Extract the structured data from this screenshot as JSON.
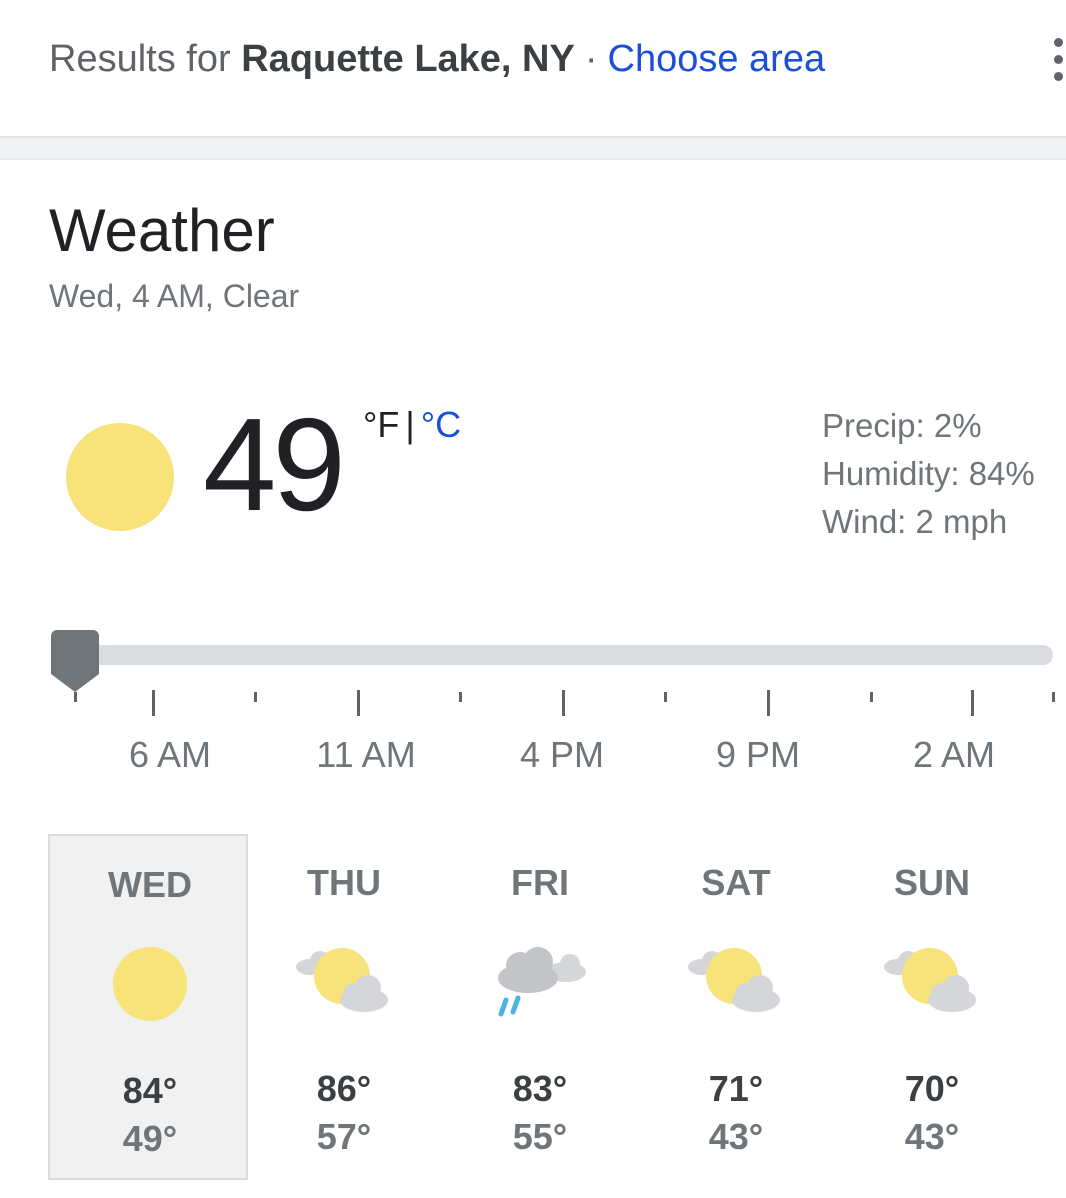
{
  "header": {
    "results_prefix": "Results for",
    "location": "Raquette Lake, NY",
    "separator": "·",
    "choose_area": "Choose area",
    "more_icon": "more-vert-icon"
  },
  "weather": {
    "title": "Weather",
    "subtitle": "Wed, 4 AM, Clear",
    "condition_icon": "sun-icon",
    "temperature": "49",
    "unit_f": "°F",
    "unit_sep": "|",
    "unit_c": "°C",
    "precip": "Precip: 2%",
    "humidity": "Humidity: 84%",
    "wind": "Wind: 2 mph"
  },
  "timeline": {
    "position_fraction": 0,
    "labels": [
      "6 AM",
      "11 AM",
      "4 PM",
      "9 PM",
      "2 AM"
    ]
  },
  "colors": {
    "sun": "#f8e27a",
    "link": "#1a4fd6",
    "rain": "#4fb3e0"
  },
  "forecast": [
    {
      "day": "WED",
      "icon": "sun-icon",
      "high": "84°",
      "low": "49°",
      "selected": true
    },
    {
      "day": "THU",
      "icon": "partly-cloudy-icon",
      "high": "86°",
      "low": "57°",
      "selected": false
    },
    {
      "day": "FRI",
      "icon": "rain-cloud-icon",
      "high": "83°",
      "low": "55°",
      "selected": false
    },
    {
      "day": "SAT",
      "icon": "partly-cloudy-icon",
      "high": "71°",
      "low": "43°",
      "selected": false
    },
    {
      "day": "SUN",
      "icon": "partly-cloudy-icon",
      "high": "70°",
      "low": "43°",
      "selected": false
    }
  ]
}
